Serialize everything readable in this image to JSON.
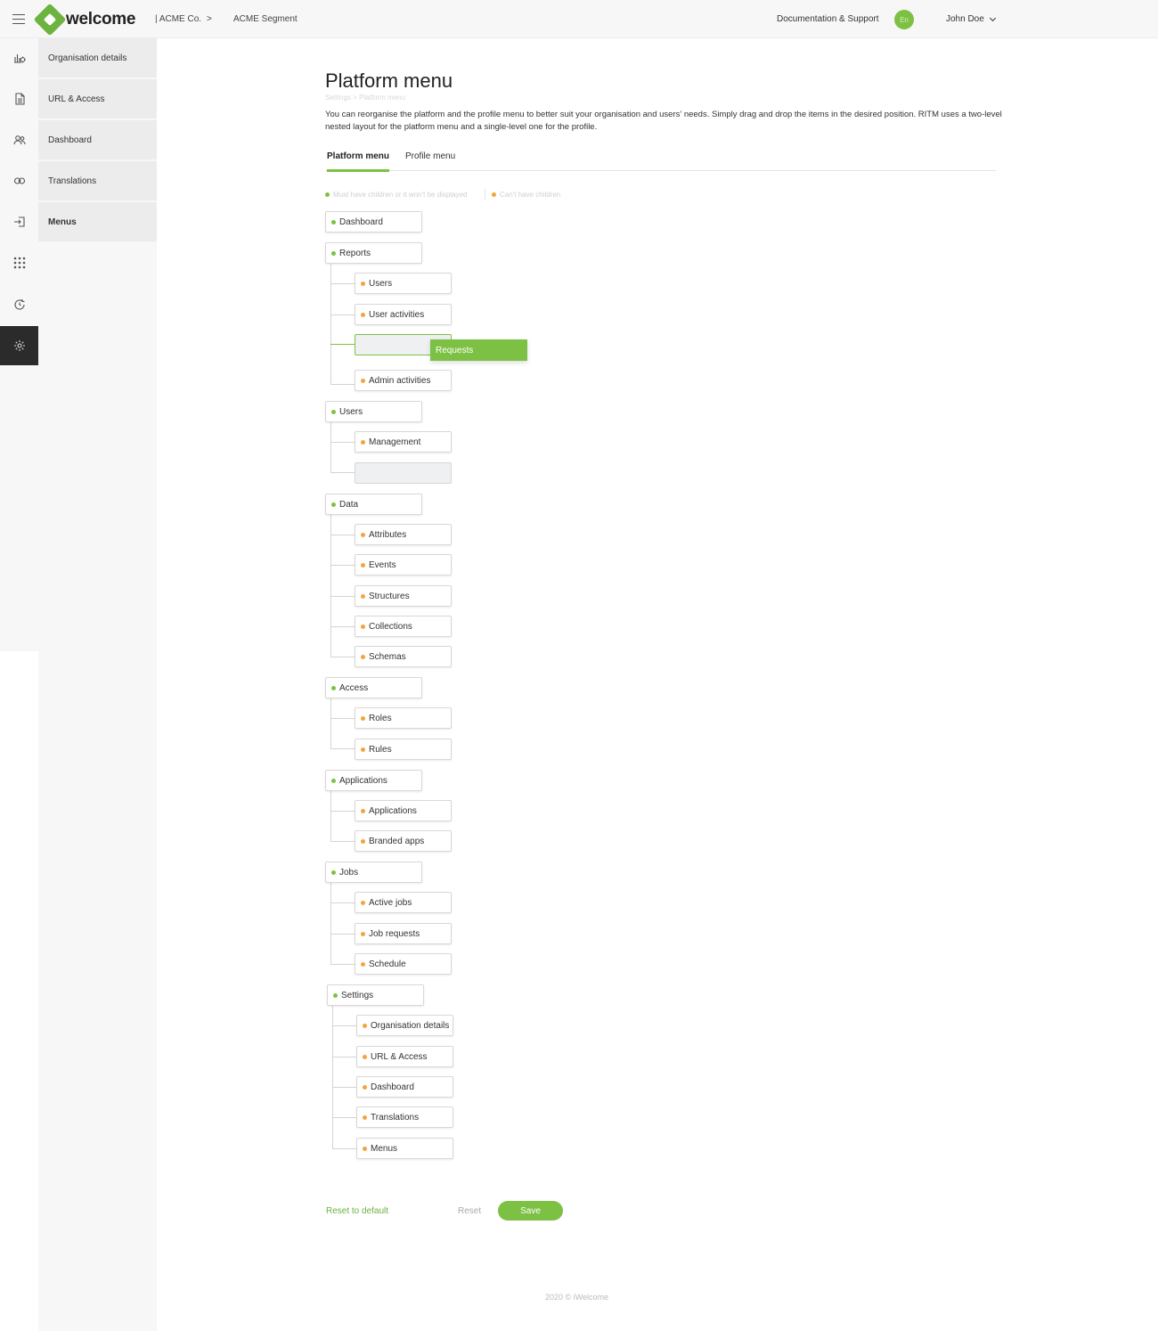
{
  "header": {
    "logo_text": "welcome",
    "company": "| ACME Co.",
    "crumb_separator": ">",
    "segment": "ACME Segment",
    "doc_link": "Documentation & Support",
    "language": "En",
    "user_name": "John Doe"
  },
  "submenu": {
    "items": [
      {
        "label": "Organisation details"
      },
      {
        "label": "URL & Access"
      },
      {
        "label": "Dashboard"
      },
      {
        "label": "Translations"
      },
      {
        "label": "Menus",
        "active": true
      }
    ]
  },
  "page": {
    "title": "Platform menu",
    "breadcrumb": "Settings > Platform menu",
    "description": "You can reorganise the platform and the profile menu to better suit your organisation and users' needs. Simply drag and drop the items in the desired position. RITM uses a two-level nested layout for the platform menu and a single-level one for the profile.",
    "tabs": [
      {
        "label": "Platform menu",
        "active": true
      },
      {
        "label": "Profile menu",
        "active": false
      }
    ],
    "legend": {
      "green_label": "Must have children or it won't be displayed",
      "orange_label": "Can't have children"
    },
    "colors": {
      "accent": "#7cc143",
      "parent_dot": "#7cc143",
      "child_dot": "#f5a43a"
    }
  },
  "menu_tree": [
    {
      "label": "Dashboard",
      "children": []
    },
    {
      "label": "Reports",
      "children": [
        {
          "label": "Users"
        },
        {
          "label": "User activities"
        },
        {
          "placeholder": true,
          "drop_target": true
        },
        {
          "label": "Admin activities"
        }
      ]
    },
    {
      "label": "Users",
      "children": [
        {
          "label": "Management"
        },
        {
          "placeholder": true
        }
      ]
    },
    {
      "label": "Data",
      "children": [
        {
          "label": "Attributes"
        },
        {
          "label": "Events"
        },
        {
          "label": "Structures"
        },
        {
          "label": "Collections"
        },
        {
          "label": "Schemas"
        }
      ]
    },
    {
      "label": "Access",
      "children": [
        {
          "label": "Roles"
        },
        {
          "label": "Rules"
        }
      ]
    },
    {
      "label": "Applications",
      "children": [
        {
          "label": "Applications"
        },
        {
          "label": "Branded apps"
        }
      ]
    },
    {
      "label": "Jobs",
      "children": [
        {
          "label": "Active jobs"
        },
        {
          "label": "Job requests"
        },
        {
          "label": "Schedule"
        }
      ]
    },
    {
      "label": "Settings",
      "children": [
        {
          "label": "Organisation details"
        },
        {
          "label": "URL & Access"
        },
        {
          "label": "Dashboard"
        },
        {
          "label": "Translations"
        },
        {
          "label": "Menus"
        }
      ]
    }
  ],
  "dragging": {
    "label": "Requests"
  },
  "actions": {
    "reset_default": "Reset to default",
    "reset": "Reset",
    "save": "Save"
  },
  "footer": {
    "text": "2020 © iWelcome"
  }
}
